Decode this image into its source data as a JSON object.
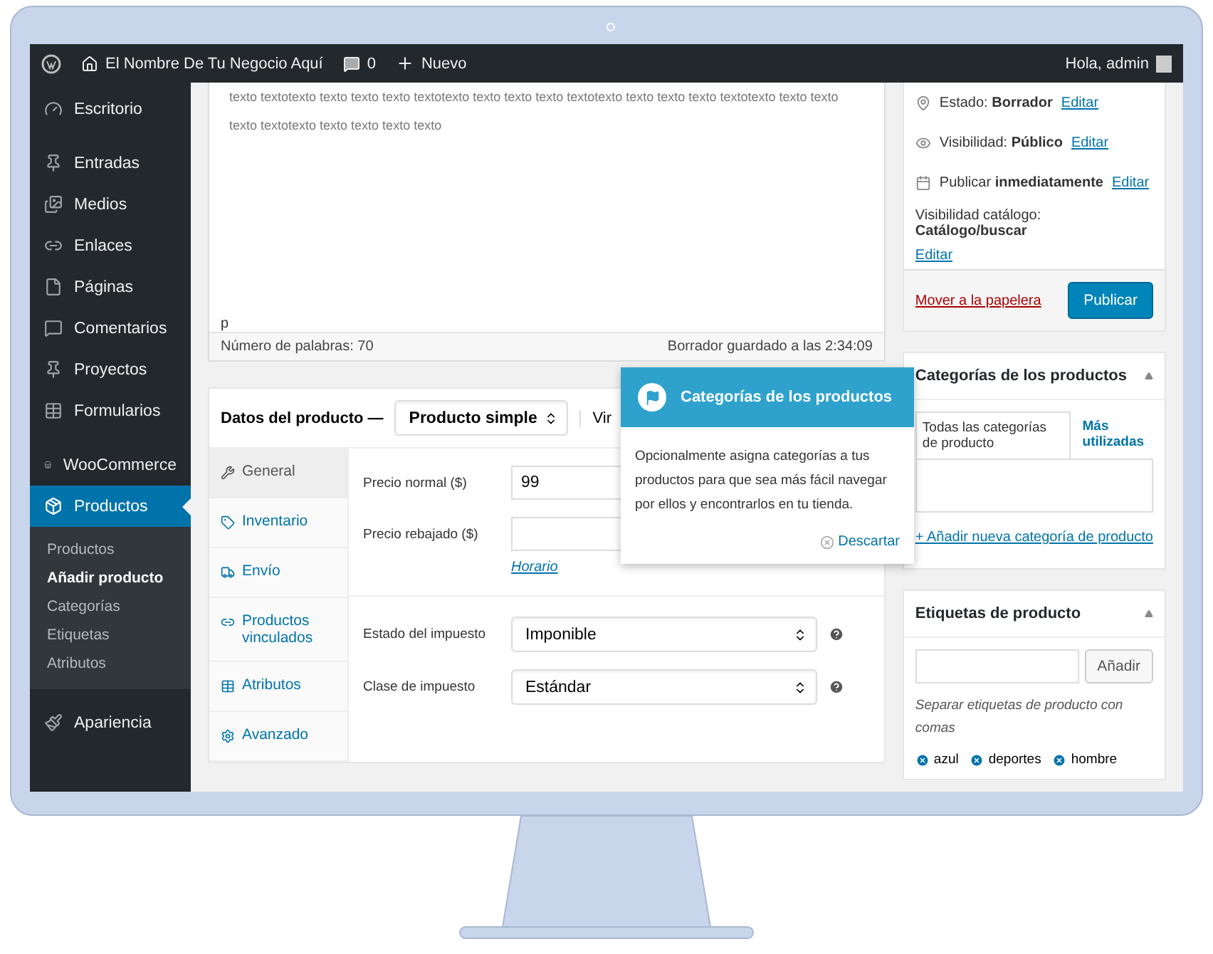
{
  "admin_bar": {
    "site": "El Nombre De Tu Negocio Aquí",
    "comments": "0",
    "new": "Nuevo",
    "greeting": "Hola, admin"
  },
  "sidebar": {
    "groups": [
      {
        "items": [
          {
            "label": "Escritorio",
            "selected": false
          }
        ]
      },
      {
        "items": [
          {
            "label": "Entradas",
            "selected": false
          },
          {
            "label": "Medios",
            "selected": false
          },
          {
            "label": "Enlaces",
            "selected": false
          },
          {
            "label": "Páginas",
            "selected": false
          },
          {
            "label": "Comentarios",
            "selected": false
          },
          {
            "label": "Proyectos",
            "selected": false
          },
          {
            "label": "Formularios",
            "selected": false
          }
        ]
      },
      {
        "items": [
          {
            "label": "WooCommerce",
            "selected": false
          },
          {
            "label": "Productos",
            "selected": true,
            "children": [
              {
                "label": "Productos",
                "selected": false
              },
              {
                "label": "Añadir producto",
                "selected": true
              },
              {
                "label": "Categorías",
                "selected": false
              },
              {
                "label": "Etiquetas",
                "selected": false
              },
              {
                "label": "Atributos",
                "selected": false
              }
            ]
          }
        ]
      },
      {
        "items": [
          {
            "label": "Apariencia",
            "selected": false
          }
        ]
      }
    ]
  },
  "editor": {
    "lines": [
      "texto textotexto texto texto texto textotexto texto texto texto textotexto texto texto texto textotexto texto texto",
      "texto textotexto texto texto texto texto"
    ],
    "path": "p",
    "word_count": "Número de palabras: 70",
    "saved": "Borrador guardado a las 2:34:09"
  },
  "product_data": {
    "title": "Datos del producto —",
    "type": "Producto simple",
    "option_cut": "Vir",
    "tabs": [
      {
        "label": "General",
        "selected": true
      },
      {
        "label": "Inventario",
        "selected": false
      },
      {
        "label": "Envío",
        "selected": false
      },
      {
        "label": "Productos vinculados",
        "selected": false
      },
      {
        "label": "Atributos",
        "selected": false
      },
      {
        "label": "Avanzado",
        "selected": false
      }
    ],
    "fields": [
      {
        "kind": "input",
        "label": "Precio normal ($)",
        "value": "99"
      },
      {
        "kind": "input",
        "label": "Precio rebajado ($)",
        "link": "Horario"
      },
      {
        "kind": "divider"
      },
      {
        "kind": "select",
        "label": "Estado del impuesto",
        "value": "Imponible"
      },
      {
        "kind": "select",
        "label": "Clase de impuesto",
        "value": "Estándar"
      }
    ]
  },
  "tooltip": {
    "title": "Categorías de los productos",
    "body": "Opcionalmente asigna categorías a tus productos para que sea más fácil navegar por ellos y encontrarlos en tu tienda.",
    "dismiss": "Descartar"
  },
  "publish": {
    "rows": [
      {
        "text": "Estado: **Borrador**",
        "link": "Editar"
      },
      {
        "text": "Visibilidad: **Público**",
        "link": "Editar"
      },
      {
        "text": "Publicar **inmediatamente**",
        "link": "Editar"
      },
      {
        "text": "Visibilidad catálogo: **Catálogo/buscar**",
        "link": "Editar"
      }
    ],
    "trash": "Mover a la papelera",
    "button": "Publicar"
  },
  "categories": {
    "title": "Categorías de los productos",
    "tabs": [
      {
        "label": "Todas las categorías de producto",
        "selected": true
      },
      {
        "label": "Más utilizadas",
        "selected": false
      }
    ],
    "add_link": "+ Añadir nueva categoría de producto"
  },
  "tags": {
    "title": "Etiquetas de producto",
    "button": "Añadir",
    "hint": "Separar etiquetas de producto con comas",
    "items": [
      "azul",
      "deportes",
      "hombre"
    ]
  }
}
